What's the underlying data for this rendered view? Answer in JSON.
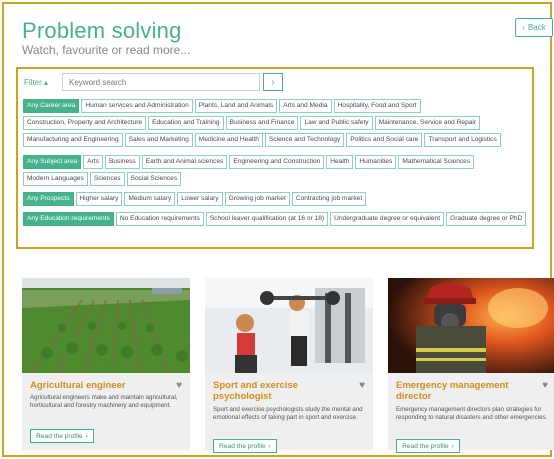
{
  "header": {
    "title": "Problem solving",
    "subtitle": "Watch, favourite or read more...",
    "back_label": "Back"
  },
  "filter": {
    "label": "Filter",
    "search_placeholder": "Keyword search",
    "career": {
      "head": "Any Career area",
      "items": [
        "Human services and Administration",
        "Plants, Land and Animals",
        "Arts and Media",
        "Hospitality, Food and Sport",
        "Construction, Property and Architecture",
        "Education and Training",
        "Business and Finance",
        "Law and Public safety",
        "Maintenance, Service and Repair",
        "Manufacturing and Engineering",
        "Sales and Marketing",
        "Medicine and Health",
        "Science and Technology",
        "Politics and Social care",
        "Transport and Logistics"
      ]
    },
    "subject": {
      "head": "Any Subject area",
      "items": [
        "Arts",
        "Business",
        "Earth and Animal sciences",
        "Engineering and Construction",
        "Health",
        "Humanities",
        "Mathematical Sciences",
        "Modern Languages",
        "Sciences",
        "Social Sciences"
      ]
    },
    "prospects": {
      "head": "Any Prospects",
      "items": [
        "Higher salary",
        "Medium salary",
        "Lower salary",
        "Growing job market",
        "Contracting job market"
      ]
    },
    "education": {
      "head": "Any Education requirements",
      "items": [
        "No Education requirements",
        "School leaver qualification (at 16 or 18)",
        "Undergraduate degree or equivalent",
        "Graduate degree or PhD"
      ]
    }
  },
  "cards": [
    {
      "title": "Agricultural engineer",
      "description": "Agricultural engineers make and maintain agricultural, horticultural and forestry machinery and equipment.",
      "button": "Read the profile"
    },
    {
      "title": "Sport and exercise psychologist",
      "description": "Sport and exercise psychologists study the mental and emotional effects of taking part in sport and exercise.",
      "button": "Read the profile"
    },
    {
      "title": "Emergency management director",
      "description": "Emergency management directors plan strategies for responding to natural disasters and other emergencies.",
      "button": "Read the profile"
    }
  ],
  "colors": {
    "accent": "#46b18f",
    "card_title": "#d38d1d",
    "highlight_border": "#c9a227"
  },
  "icons": {
    "back": "chevron-left-icon",
    "search": "chevron-right-icon",
    "favourite": "heart-icon",
    "read": "chevron-right-icon"
  }
}
